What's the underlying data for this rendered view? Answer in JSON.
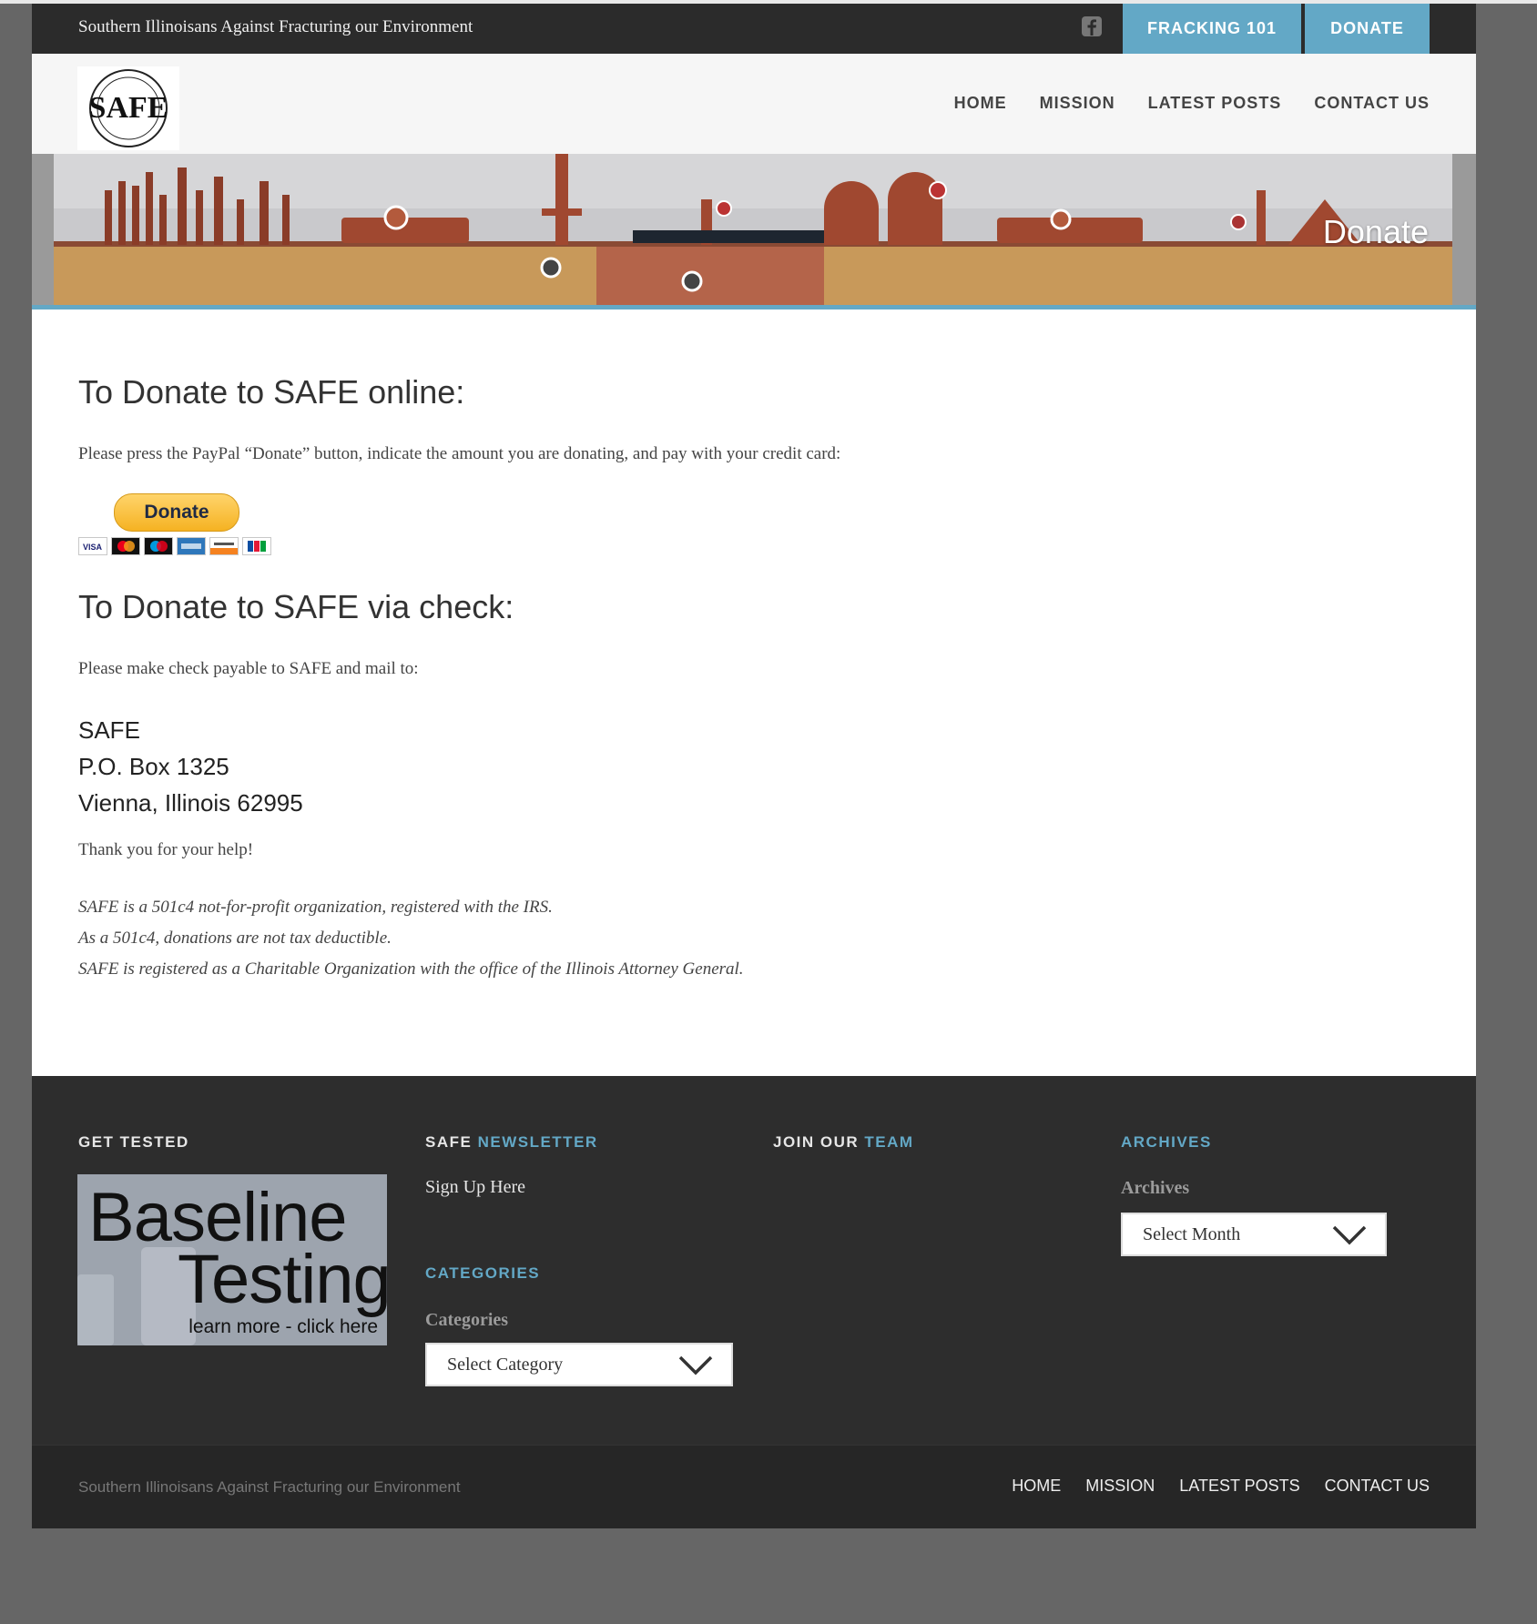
{
  "site": {
    "tagline": "Southern Illinoisans Against Fracturing our Environment",
    "logo_text": "SAFE",
    "top_buttons": [
      "FRACKING 101",
      "DONATE"
    ],
    "nav": [
      "HOME",
      "MISSION",
      "LATEST POSTS",
      "CONTACT US"
    ]
  },
  "banner": {
    "title": "Donate"
  },
  "content": {
    "online_heading": "To Donate to SAFE online:",
    "online_text": "Please press the PayPal “Donate” button, indicate the amount you are donating, and pay with your credit card:",
    "paypal_label": "Donate",
    "card_icons": [
      "visa-card-icon",
      "mastercard-card-icon",
      "maestro-card-icon",
      "amex-card-icon",
      "discover-card-icon",
      "jcb-card-icon"
    ],
    "check_heading": "To Donate to SAFE via check:",
    "check_text": "Please make check payable to SAFE and mail to:",
    "address": [
      "SAFE",
      "P.O. Box 1325",
      "Vienna, Illinois 62995"
    ],
    "thanks": "Thank you for your help!",
    "notes": [
      "SAFE is a 501c4 not-for-profit organization, registered with the IRS.",
      "As a 501c4, donations are not tax deductible.",
      "SAFE is registered as a Charitable Organization with the office of the Illinois Attorney General."
    ]
  },
  "footer": {
    "get_tested": {
      "title": "GET TESTED",
      "image_lines": [
        "Baseline",
        "Testing",
        "learn more - click here"
      ]
    },
    "newsletter": {
      "title_plain": "SAFE",
      "title_accent": "NEWSLETTER",
      "link": "Sign Up Here"
    },
    "categories": {
      "title": "CATEGORIES",
      "label": "Categories",
      "select_value": "Select Category"
    },
    "team": {
      "title_plain": "JOIN OUR",
      "title_accent": "TEAM"
    },
    "archives": {
      "title": "ARCHIVES",
      "label": "Archives",
      "select_value": "Select Month"
    },
    "copyright": "Southern Illinoisans Against Fracturing our Environment",
    "nav": [
      "HOME",
      "MISSION",
      "LATEST POSTS",
      "CONTACT US"
    ]
  },
  "colors": {
    "accent": "#63a8c6",
    "dark": "#2d2d2d",
    "paypal": "#f5b222"
  }
}
